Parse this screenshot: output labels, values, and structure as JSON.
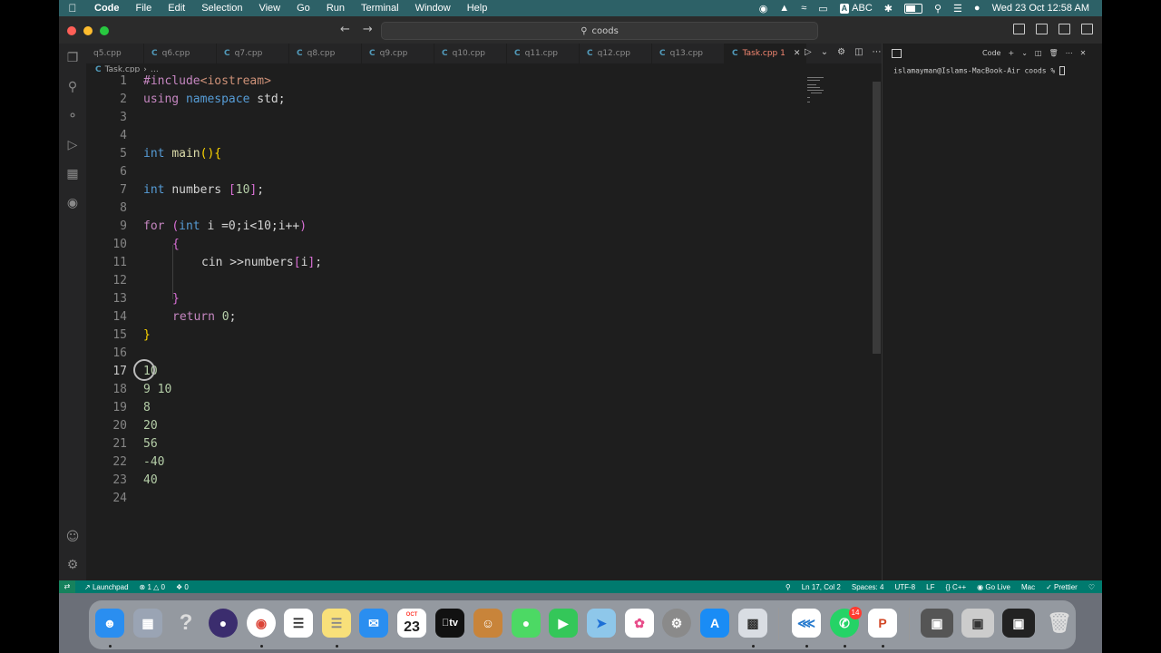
{
  "menubar": {
    "app": "Code",
    "items": [
      "File",
      "Edit",
      "Selection",
      "View",
      "Go",
      "Run",
      "Terminal",
      "Window",
      "Help"
    ],
    "input_source": "ABC",
    "datetime": "Wed 23 Oct  12:58 AM"
  },
  "titlebar": {
    "search": "coods"
  },
  "tabs": [
    {
      "label": "q5.cpp"
    },
    {
      "label": "q6.cpp"
    },
    {
      "label": "q7.cpp"
    },
    {
      "label": "q8.cpp"
    },
    {
      "label": "q9.cpp"
    },
    {
      "label": "q10.cpp"
    },
    {
      "label": "q11.cpp"
    },
    {
      "label": "q12.cpp"
    },
    {
      "label": "q13.cpp"
    },
    {
      "label": "Task.cpp 1",
      "active": true
    }
  ],
  "breadcrumb": {
    "file": "Task.cpp",
    "more": "…"
  },
  "editor": {
    "line_numbers": [
      "1",
      "2",
      "3",
      "4",
      "5",
      "6",
      "7",
      "8",
      "9",
      "10",
      "11",
      "12",
      "13",
      "14",
      "15",
      "16",
      "17",
      "18",
      "19",
      "20",
      "21",
      "22",
      "23",
      "24"
    ],
    "code": {
      "l1_hash": "#include",
      "l1_lib": "<iostream>",
      "l2_using": "using",
      "l2_ns": "namespace",
      "l2_std": "std;",
      "l5_int": "int",
      "l5_main": "main",
      "l5_paren": "()",
      "l5_brace": "{",
      "l7_int": "int",
      "l7_name": "numbers",
      "l7_lb": "[",
      "l7_num": "10",
      "l7_rb": "]",
      "l7_semi": ";",
      "l9_for": "for",
      "l9_lp": "(",
      "l9_int": "int",
      "l9_body": "i =0;i<10;i++",
      "l9_rp": ")",
      "l10_brace": "{",
      "l11_cin": "cin >>numbers",
      "l11_lb": "[",
      "l11_i": "i",
      "l11_rb": "]",
      "l11_semi": ";",
      "l13_brace": "}",
      "l14_return": "return",
      "l14_zero": "0",
      "l14_semi": ";",
      "l15_brace": "}",
      "l17": "10",
      "l18": "9 10",
      "l19": "8",
      "l20": "20",
      "l21": "56",
      "l22": "-40",
      "l23": "40"
    }
  },
  "terminal": {
    "label": "Code",
    "prompt": "islamayman@Islams-MacBook-Air coods % "
  },
  "statusbar": {
    "launchpad": "Launchpad",
    "errors": "1",
    "warnings": "0",
    "ports": "0",
    "position": "Ln 17, Col 2",
    "spaces": "Spaces: 4",
    "encoding": "UTF-8",
    "eol": "LF",
    "language": "C++",
    "golive": "Go Live",
    "mac": "Mac",
    "prettier": "Prettier"
  },
  "dock": {
    "calendar_month": "OCT",
    "calendar_day": "23",
    "appletv": "tv",
    "whatsapp_badge": "14"
  },
  "colors": {
    "menubar": "#2d6167",
    "statusbar": "#007a6e",
    "editor_bg": "#1e1e1e",
    "active_tab_text": "#f48771"
  }
}
